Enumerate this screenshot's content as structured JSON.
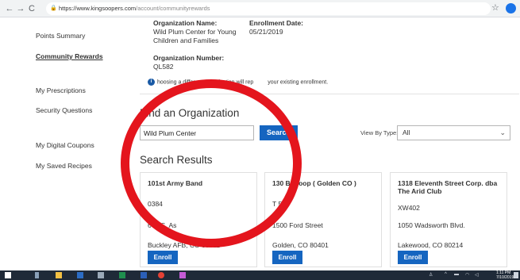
{
  "browser": {
    "url_host": "https://www.kingsoopers.com",
    "url_path": "/account/communityrewards",
    "back": "←",
    "forward": "→",
    "reload": "C",
    "home": "⌂",
    "star": "☆"
  },
  "nav": {
    "items": [
      "Points Summary",
      "Community Rewards",
      "My Prescriptions",
      "Security Questions",
      "My Digital Coupons",
      "My Saved Recipes"
    ]
  },
  "enrollment": {
    "org_name_label": "Organization Name:",
    "org_name_line1": "Wild Plum Center for Young",
    "org_name_line2": "Children and Families",
    "date_label": "Enrollment Date:",
    "date": "05/21/2019",
    "number_label": "Organization Number:",
    "number": "QL582",
    "note_start": "hoosing a different organization will rep",
    "note_end": "your existing enrollment.",
    "info_icon": "i"
  },
  "find": {
    "title": "Find an Organization",
    "query": "Wild Plum Center",
    "search_label": "Search",
    "view_by_label": "View By Type:",
    "view_by_value": "All",
    "chevron": "⌄"
  },
  "results": {
    "title": "Search Results",
    "enroll_label": "Enroll",
    "cards": [
      {
        "name": "101st Army Band",
        "number": "0384",
        "address": "660 S. As",
        "city": "Buckley AFB, CO 80011"
      },
      {
        "name": "130 B   Troop ( Golden CO )",
        "number": "T   50",
        "address": "1500 Ford Street",
        "city": "Golden, CO 80401"
      },
      {
        "name": "1318 Eleventh Street Corp. dba The Arid Club",
        "number": "XW402",
        "address": "1050 Wadsworth Blvd.",
        "city": "Lakewood, CO 80214"
      }
    ]
  },
  "taskbar": {
    "time": "1:11 PM",
    "date": "7/10/2019"
  },
  "colors": {
    "primary_blue": "#1565c0",
    "circle_red": "#e4151d",
    "taskbar": "#1f2a38"
  }
}
